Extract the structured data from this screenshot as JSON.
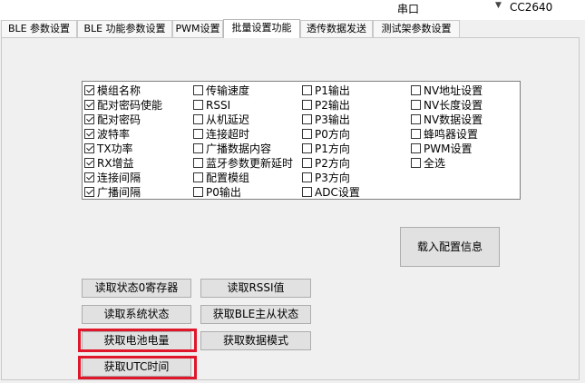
{
  "topbar": {
    "port_label": "串口",
    "port_value": "CC2640",
    "dropdown_arrow": "▼"
  },
  "tabs": [
    {
      "label": "BLE 参数设置"
    },
    {
      "label": "BLE 功能参数设置"
    },
    {
      "label": "PWM设置"
    },
    {
      "label": "批量设置功能"
    },
    {
      "label": "透传数据发送"
    },
    {
      "label": "测试架参数设置"
    }
  ],
  "checkboxes": {
    "col1": [
      {
        "label": "模组名称",
        "checked": true
      },
      {
        "label": "配对密码使能",
        "checked": true
      },
      {
        "label": "配对密码",
        "checked": true
      },
      {
        "label": "波特率",
        "checked": true
      },
      {
        "label": "TX功率",
        "checked": true
      },
      {
        "label": "RX增益",
        "checked": true
      },
      {
        "label": "连接间隔",
        "checked": true
      },
      {
        "label": "广播间隔",
        "checked": true
      }
    ],
    "col2": [
      {
        "label": "传输速度",
        "checked": false
      },
      {
        "label": "RSSI",
        "checked": false
      },
      {
        "label": "从机延迟",
        "checked": false
      },
      {
        "label": "连接超时",
        "checked": false
      },
      {
        "label": "广播数据内容",
        "checked": false
      },
      {
        "label": "蓝牙参数更新延时",
        "checked": false
      },
      {
        "label": "配置模组",
        "checked": false
      },
      {
        "label": "P0输出",
        "checked": false
      }
    ],
    "col3": [
      {
        "label": "P1输出",
        "checked": false
      },
      {
        "label": "P2输出",
        "checked": false
      },
      {
        "label": "P3输出",
        "checked": false
      },
      {
        "label": "P0方向",
        "checked": false
      },
      {
        "label": "P1方向",
        "checked": false
      },
      {
        "label": "P2方向",
        "checked": false
      },
      {
        "label": "P3方向",
        "checked": false
      },
      {
        "label": "ADC设置",
        "checked": false
      }
    ],
    "col4": [
      {
        "label": "NV地址设置",
        "checked": false
      },
      {
        "label": "NV长度设置",
        "checked": false
      },
      {
        "label": "NV数据设置",
        "checked": false
      },
      {
        "label": "蜂鸣器设置",
        "checked": false
      },
      {
        "label": "PWM设置",
        "checked": false
      },
      {
        "label": "全选",
        "checked": false
      }
    ]
  },
  "buttons": {
    "load_config": "载入配置信息",
    "read_status0": "读取状态0寄存器",
    "read_rssi": "读取RSSI值",
    "read_system_status": "读取系统状态",
    "get_ble_role_status": "获取BLE主从状态",
    "get_battery": "获取电池电量",
    "get_data_mode": "获取数据模式",
    "get_utc_time": "获取UTC时间"
  },
  "highlight_color": "#e0172b"
}
